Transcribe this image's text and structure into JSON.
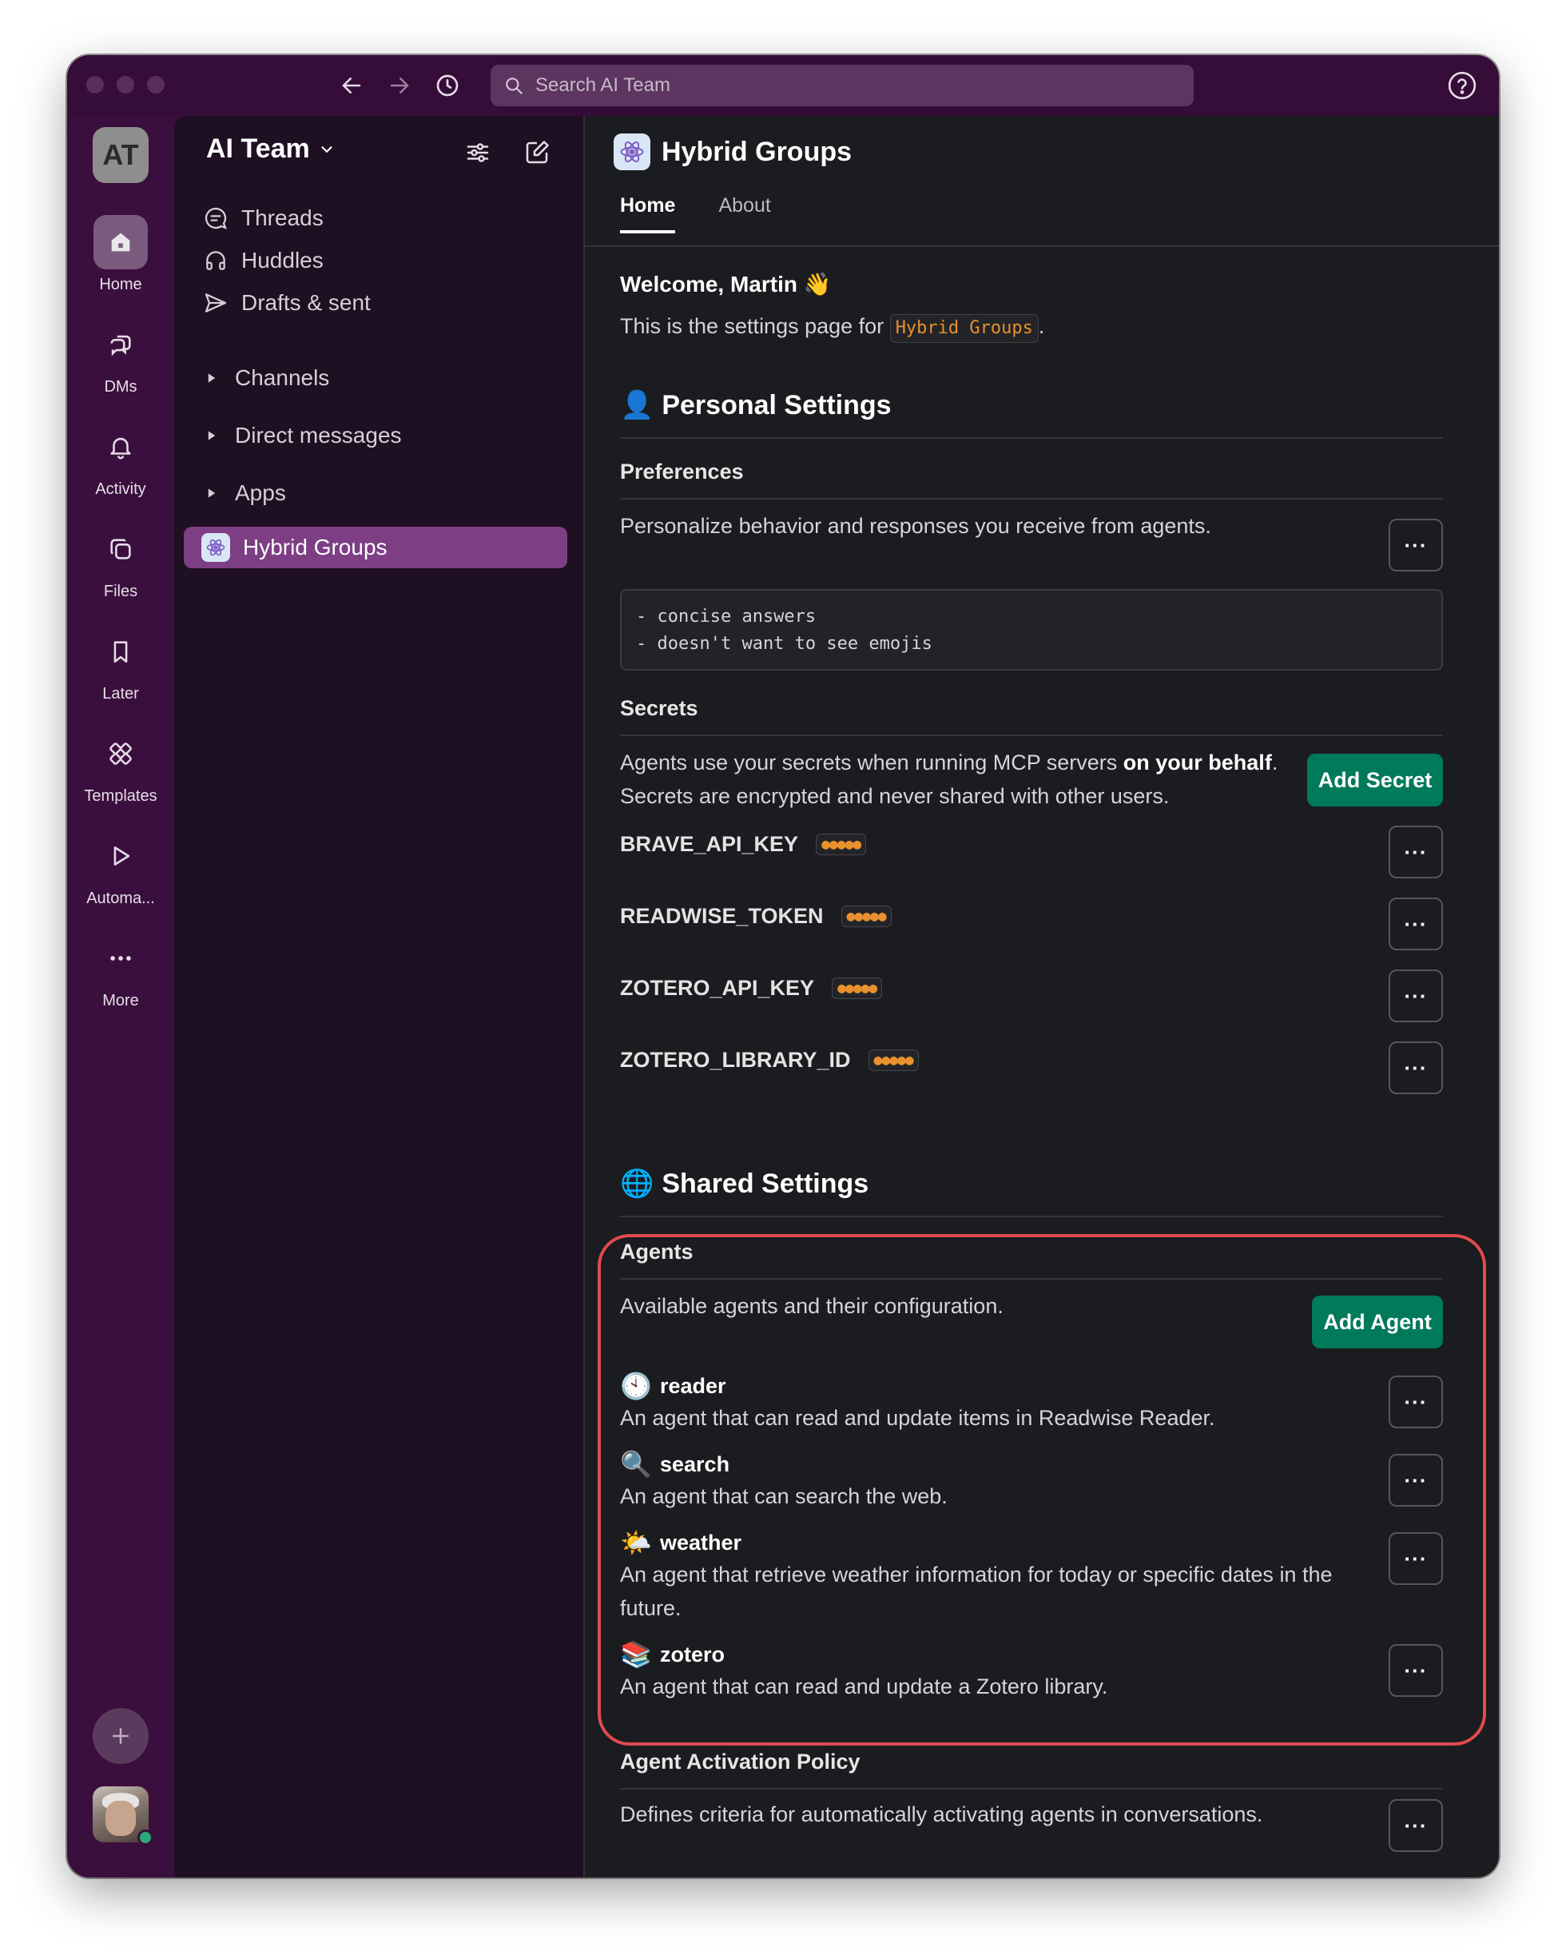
{
  "titlebar": {
    "search_placeholder": "Search AI Team"
  },
  "rail": {
    "workspace_initials": "AT",
    "items": [
      {
        "label": "Home",
        "icon": "home-icon"
      },
      {
        "label": "DMs",
        "icon": "dms-icon"
      },
      {
        "label": "Activity",
        "icon": "bell-icon"
      },
      {
        "label": "Files",
        "icon": "files-icon"
      },
      {
        "label": "Later",
        "icon": "bookmark-icon"
      },
      {
        "label": "Templates",
        "icon": "templates-icon"
      },
      {
        "label": "Automa...",
        "icon": "play-icon"
      },
      {
        "label": "More",
        "icon": "more-icon"
      }
    ]
  },
  "sidebar": {
    "workspace_name": "AI Team",
    "items": [
      {
        "label": "Threads",
        "icon": "threads-icon"
      },
      {
        "label": "Huddles",
        "icon": "headphones-icon"
      },
      {
        "label": "Drafts & sent",
        "icon": "send-icon"
      }
    ],
    "sections": [
      {
        "label": "Channels"
      },
      {
        "label": "Direct messages"
      },
      {
        "label": "Apps"
      }
    ],
    "active_app": "Hybrid Groups"
  },
  "main": {
    "title": "Hybrid Groups",
    "tabs": [
      {
        "label": "Home"
      },
      {
        "label": "About"
      }
    ],
    "welcome": "Welcome, Martin",
    "welcome_emoji": "👋",
    "intro_prefix": "This is the settings page for",
    "intro_code": "Hybrid Groups",
    "intro_suffix": ".",
    "personal": {
      "heading": "Personal Settings",
      "emoji": "👤",
      "preferences_heading": "Preferences",
      "preferences_desc": "Personalize behavior and responses you receive from agents.",
      "preferences_code": "- concise answers\n- doesn't want to see emojis",
      "secrets_heading": "Secrets",
      "secrets_desc_1": "Agents use your secrets when running MCP servers ",
      "secrets_desc_bold": "on your behalf",
      "secrets_desc_2": ".",
      "secrets_desc_line2": "Secrets are encrypted and never shared with other users.",
      "add_secret_label": "Add Secret",
      "secrets": [
        {
          "name": "BRAVE_API_KEY",
          "masked": "●●●●●"
        },
        {
          "name": "READWISE_TOKEN",
          "masked": "●●●●●"
        },
        {
          "name": "ZOTERO_API_KEY",
          "masked": "●●●●●"
        },
        {
          "name": "ZOTERO_LIBRARY_ID",
          "masked": "●●●●●"
        }
      ]
    },
    "shared": {
      "heading": "Shared Settings",
      "emoji": "🌐",
      "agents_heading": "Agents",
      "agents_desc": "Available agents and their configuration.",
      "add_agent_label": "Add Agent",
      "agents": [
        {
          "emoji": "🕙",
          "name": "reader",
          "desc": "An agent that can read and update items in Readwise Reader."
        },
        {
          "emoji": "🔍",
          "name": "search",
          "desc": "An agent that can search the web."
        },
        {
          "emoji": "🌤️",
          "name": "weather",
          "desc": "An agent that retrieve weather information for today or specific dates in the future."
        },
        {
          "emoji": "📚",
          "name": "zotero",
          "desc": "An agent that can read and update a Zotero library."
        }
      ],
      "policy_heading": "Agent Activation Policy",
      "policy_desc": "Defines criteria for automatically activating agents in conversations."
    },
    "more_label": "···"
  },
  "colors": {
    "accent_green": "#007a5a",
    "sidebar_active": "#7d3e84",
    "annotation_red": "#e04b4f",
    "code_orange": "#e8912d"
  }
}
